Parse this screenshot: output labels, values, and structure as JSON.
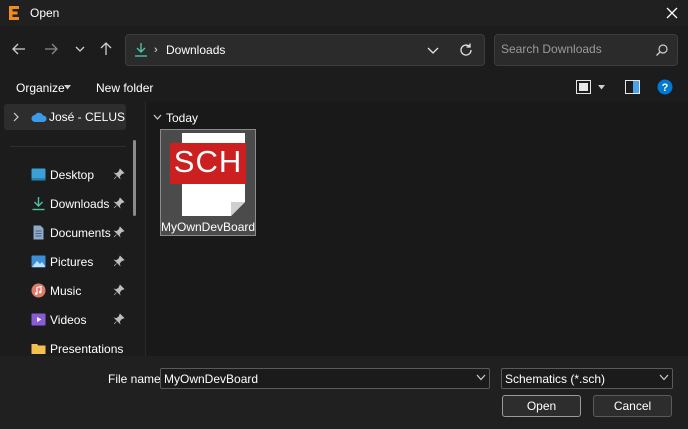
{
  "window": {
    "title": "Open"
  },
  "address": {
    "crumb": "Downloads"
  },
  "search": {
    "placeholder": "Search Downloads"
  },
  "toolbar": {
    "organize_label": "Organize",
    "new_folder_label": "New folder"
  },
  "sidebar": {
    "cloud_item": "José - CELUS GmbH",
    "items": [
      {
        "label": "Desktop",
        "icon": "desktop-icon"
      },
      {
        "label": "Downloads",
        "icon": "download-icon"
      },
      {
        "label": "Documents",
        "icon": "documents-icon"
      },
      {
        "label": "Pictures",
        "icon": "pictures-icon"
      },
      {
        "label": "Music",
        "icon": "music-icon"
      },
      {
        "label": "Videos",
        "icon": "videos-icon"
      },
      {
        "label": "Presentations",
        "icon": "folder-icon"
      }
    ]
  },
  "content": {
    "group_label": "Today",
    "files": [
      {
        "name": "MyOwnDevBoard",
        "badge": "SCH"
      }
    ]
  },
  "footer": {
    "filename_label": "File name:",
    "filename_value": "MyOwnDevBoard",
    "filetype_value": "Schematics (*.sch)",
    "open_label": "Open",
    "cancel_label": "Cancel"
  },
  "colors": {
    "accent": "#0078d4",
    "download_green": "#4cc2a4",
    "sch_red": "#cc1f1f"
  }
}
